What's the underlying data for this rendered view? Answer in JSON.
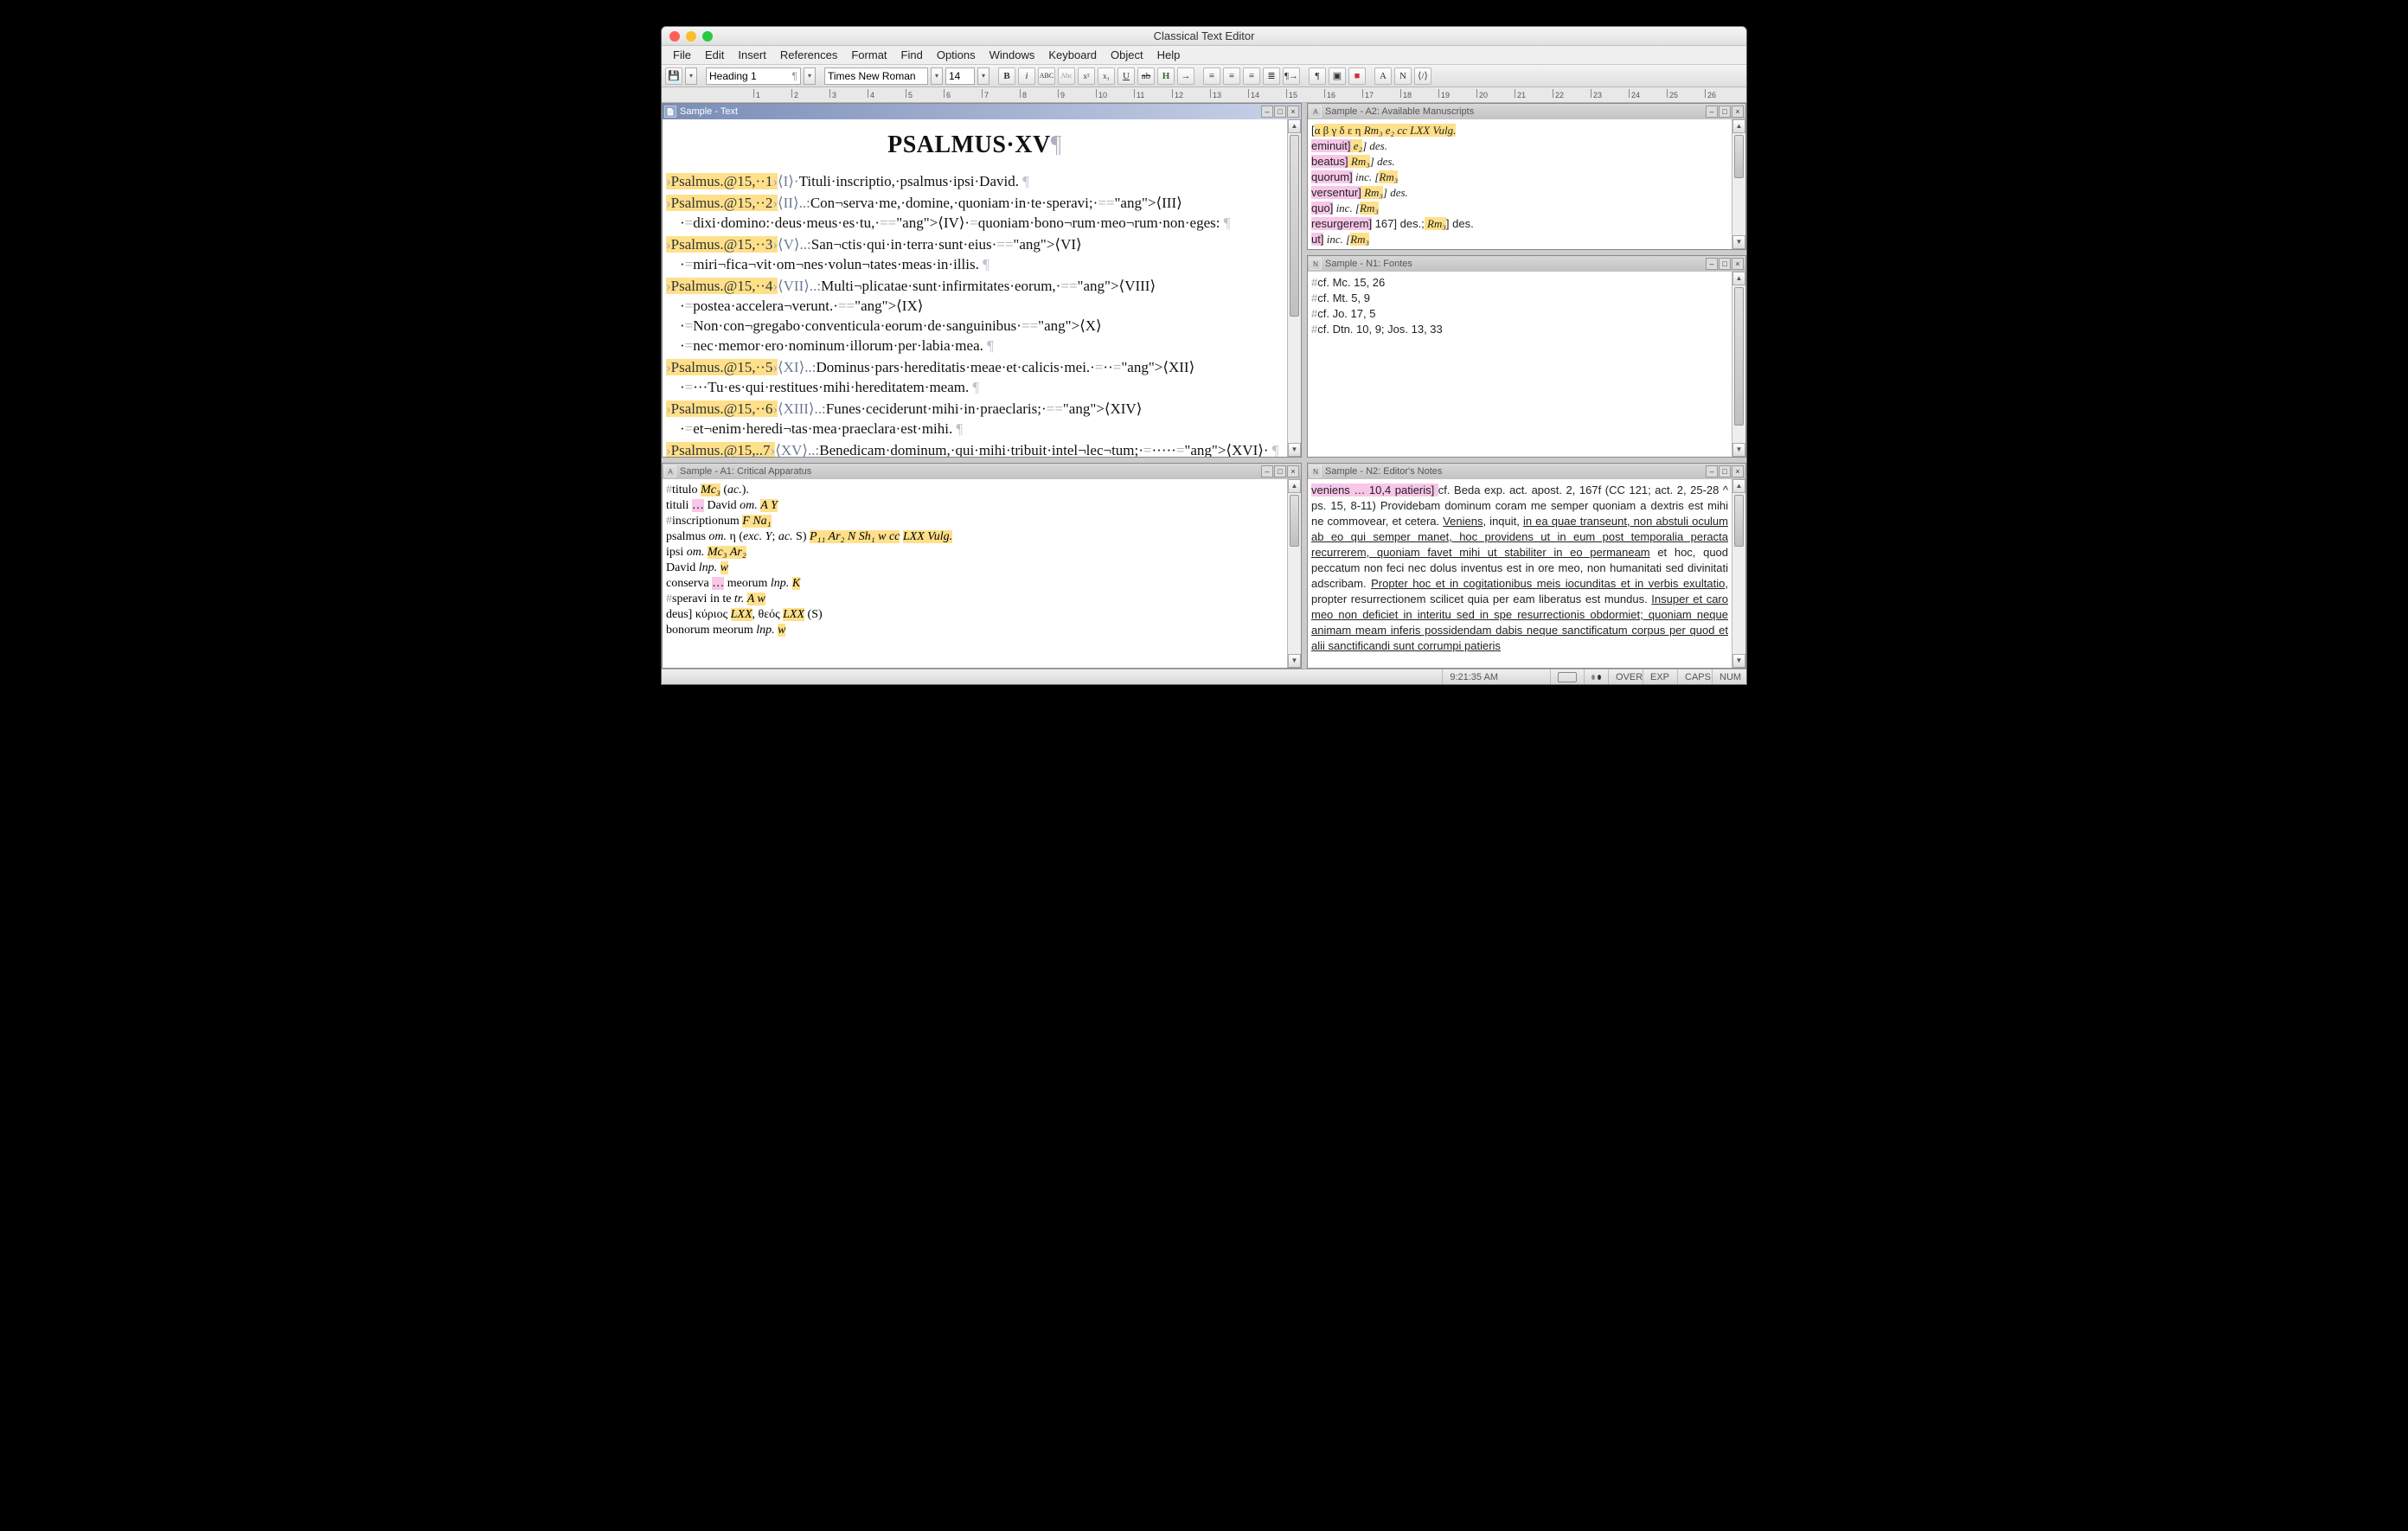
{
  "window": {
    "title": "Classical Text Editor"
  },
  "menus": [
    "File",
    "Edit",
    "Insert",
    "References",
    "Format",
    "Find",
    "Options",
    "Windows",
    "Keyboard",
    "Object",
    "Help"
  ],
  "toolbar": {
    "style": "Heading 1",
    "font": "Times New Roman",
    "size": "14"
  },
  "ruler_max": 26,
  "panes": {
    "text": {
      "title": "Sample - Text"
    },
    "manuscripts": {
      "title": "Sample - A2: Available Manuscripts"
    },
    "fontes": {
      "title": "Sample - N1: Fontes"
    },
    "apparatus": {
      "title": "Sample - A1: Critical Apparatus"
    },
    "notes": {
      "title": "Sample - N2: Editor's Notes"
    }
  },
  "heading": "PSALMUS·XV",
  "verses": [
    {
      "ref": "Psalmus.@15,··1",
      "pre": "⟨I⟩·",
      "body": "Tituli·inscriptio,·psalmus·ipsi·David."
    },
    {
      "ref": "Psalmus.@15,··2",
      "pre": "⟨II⟩..:",
      "body": "Con¬serva·me,·domine,·quoniam·in·te·speravi;·=⟨III⟩·=dixi·domino:·deus·meus·es·tu,·=⟨IV⟩·=quoniam·bono¬rum·meo¬rum·non·eges:"
    },
    {
      "ref": "Psalmus.@15,··3",
      "pre": "⟨V⟩..:",
      "body": "San¬ctis·qui·in·terra·sunt·eius·=⟨VI⟩·=miri¬fica¬vit·om¬nes·volun¬tates·meas·in·illis."
    },
    {
      "ref": "Psalmus.@15,··4",
      "pre": "⟨VII⟩..:",
      "body": "Multi¬plicatae·sunt·infirmitates·eorum,·=⟨VIII⟩·=postea·accelera¬verunt.·=⟨IX⟩·=Non·con¬gregabo·conventicula·eorum·de·sanguinibus·=⟨X⟩·=nec·memor·ero·nominum·illorum·per·labia·mea."
    },
    {
      "ref": "Psalmus.@15,··5",
      "pre": "⟨XI⟩..:",
      "body": "Dominus·pars·hereditatis·meae·et·calicis·mei.·=··⟨XII⟩·=···Tu·es·qui·restitues·mihi·hereditatem·meam."
    },
    {
      "ref": "Psalmus.@15,··6",
      "pre": "⟨XIII⟩..:",
      "body": "Funes·ceciderunt·mihi·in·praeclaris;·=⟨XIV⟩·=et¬enim·heredi¬tas·mea·praeclara·est·mihi."
    },
    {
      "ref": "Psalmus.@15,..7",
      "pre": "⟨XV⟩..:",
      "body": "Benedicam·dominum,·qui·mihi·tribuit·intel¬lec¬tum;·=·····⟨XVI⟩·"
    }
  ],
  "manuscripts": [
    {
      "sigla_hl": "α β γ δ ε η ",
      "rest_hl": "Rm₃ e₂ cc LXX Vulg.",
      "tail": ""
    },
    {
      "lemma": "eminuit]",
      "wit": " e₂",
      "note": "] des."
    },
    {
      "lemma": "beatus]",
      "wit": " Rm₃",
      "note": "] des."
    },
    {
      "lemma": "quorum]",
      "note": " inc. [",
      "wit": "Rm₃"
    },
    {
      "lemma": "versentur]",
      "wit": " Rm₃",
      "note": "] des."
    },
    {
      "lemma": "quo]",
      "note": " inc. [",
      "wit": "Rm₃"
    },
    {
      "lemma": "resurgerem]",
      "note_a": " 167] des.;",
      "wit": " Rm₃",
      "note_b": "] des."
    },
    {
      "lemma": "ut]",
      "note": " inc. [",
      "wit": "Rm₃"
    }
  ],
  "fontes": [
    "cf. Mc. 15, 26",
    "cf. Mt. 5, 9",
    "cf. Jo. 17, 5",
    "cf. Dtn. 10, 9; Jos. 13, 33"
  ],
  "apparatus": [
    {
      "html": "<span class='hash'>#</span>titulo <span class='hl-y ital'>Mc₃</span> (<span class='ital'>ac.</span>)."
    },
    {
      "html": "tituli <span class='hl-p'>…</span> David <span class='ital'>om.</span> <span class='hl-y ital'>A Y</span>"
    },
    {
      "html": "<span class='hash'>#</span>inscriptionum <span class='hl-y ital'>F Na₁</span>"
    },
    {
      "html": "psalmus <span class='ital'>om.</span> η (<span class='ital'>exc. Y</span>; <span class='ital'>ac.</span> S) <span class='hl-y ital'>P₁₁ Ar₂ N Sh₁ w cc</span> <span class='hl-y ital'>LXX Vulg.</span>"
    },
    {
      "html": "ipsi <span class='ital'>om.</span> <span class='hl-y ital'>Mc₃ Ar₂</span>"
    },
    {
      "html": "David <span class='ital'>lnp.</span> <span class='hl-y ital'>w</span>"
    },
    {
      "html": "conserva <span class='hl-p'>…</span> meorum <span class='ital'>lnp.</span> <span class='hl-y ital'>K</span>"
    },
    {
      "html": "<span class='hash'>#</span>speravi in te <span class='ital'>tr.</span> <span class='hl-y ital'>A w</span>"
    },
    {
      "html": "deus] κύριος <span class='hl-y ital'>LXX</span>, θεός <span class='hl-y ital'>LXX</span> (S)"
    },
    {
      "html": "bonorum meorum <span class='ital'>lnp.</span> <span class='hl-y ital'>w</span>"
    }
  ],
  "notes_lemma": "veniens … 10,4 patieris] ",
  "notes_body": "cf. Beda exp. act. apost. 2, 167f (CC 121; act. 2, 25-28 ^ ps. 15, 8-11) Providebam dominum coram me semper quoniam a dextris est mihi ne commovear, et cetera. <span class='u'>Veniens</span>, inquit, <span class='u'>in ea quae transeunt, non abstuli oculum ab eo qui semper manet, hoc providens ut in eum post temporalia peracta recurrerem, quoniam favet mihi ut stabiliter in eo permaneam</span> et hoc, quod peccatum non feci nec dolus inventus est in ore meo, non humanitati sed divinitati adscribam. <span class='u'>Propter hoc et in cogitationibus meis iocunditas et in verbis exultatio</span>, propter resurrectionem scilicet quia per eam liberatus est mundus. <span class='u'>Insuper et caro meo non deficiet in interitu sed in spe resurrectionis obdormiet; quoniam neque animam meam inferis possidendam dabis neque sanctificatum corpus per quod et alii sanctificandi sunt corrumpi patieris</span>",
  "status": {
    "time": "9:21:35 AM",
    "over": "OVER",
    "exp": "EXP",
    "caps": "CAPS",
    "num": "NUM"
  }
}
